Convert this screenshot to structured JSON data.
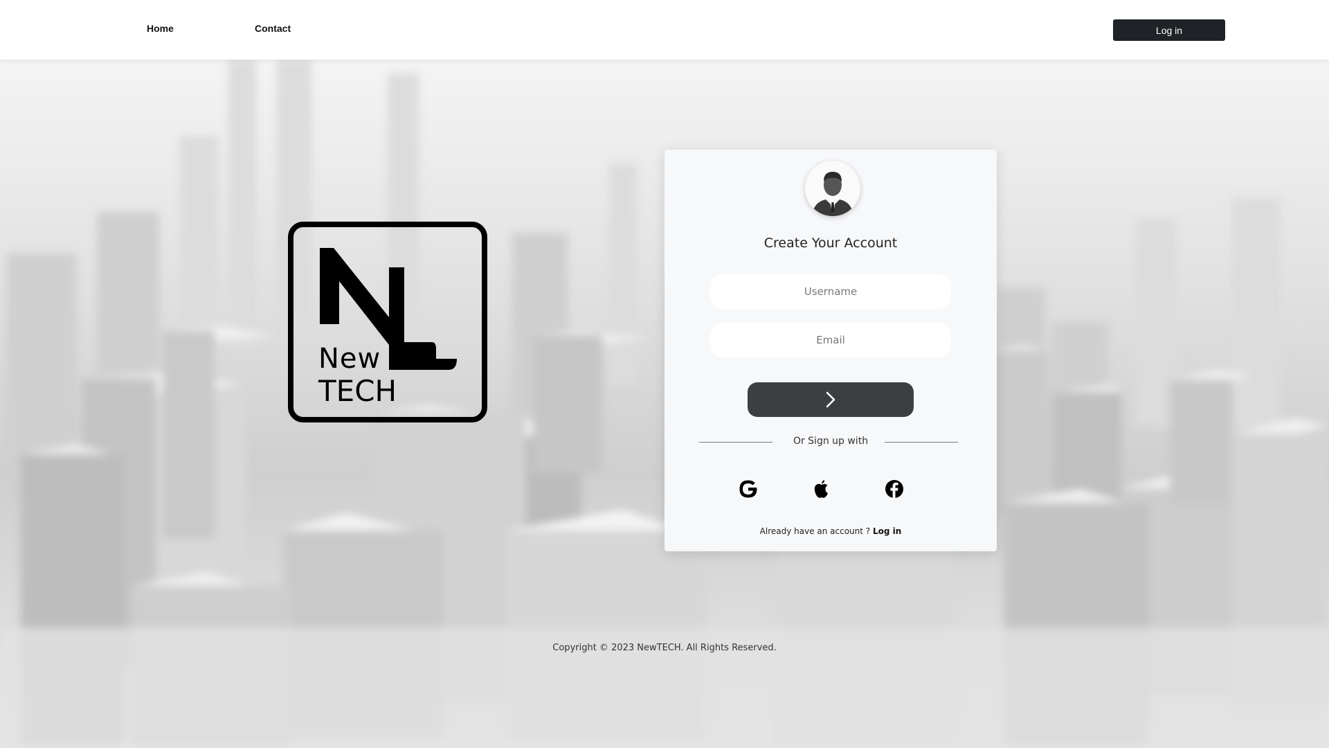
{
  "nav": {
    "home_label": "Home",
    "contact_label": "Contact",
    "login_label": "Log in"
  },
  "logo": {
    "line1": "New",
    "line2": "TECH"
  },
  "signup": {
    "title": "Create Your Account",
    "username_placeholder": "Username",
    "email_placeholder": "Email",
    "divider_text": "Or Sign up with",
    "have_account_text": "Already have an account ?",
    "login_link": "Log in",
    "social": [
      "google-icon",
      "apple-icon",
      "facebook-icon"
    ]
  },
  "footer": {
    "copyright": "Copyright © 2023 NewTECH. All Rights Reserved."
  },
  "colors": {
    "nav_button": "#1f2226",
    "submit_button": "#3c3f42",
    "card_bg": "#f7f8fa"
  }
}
